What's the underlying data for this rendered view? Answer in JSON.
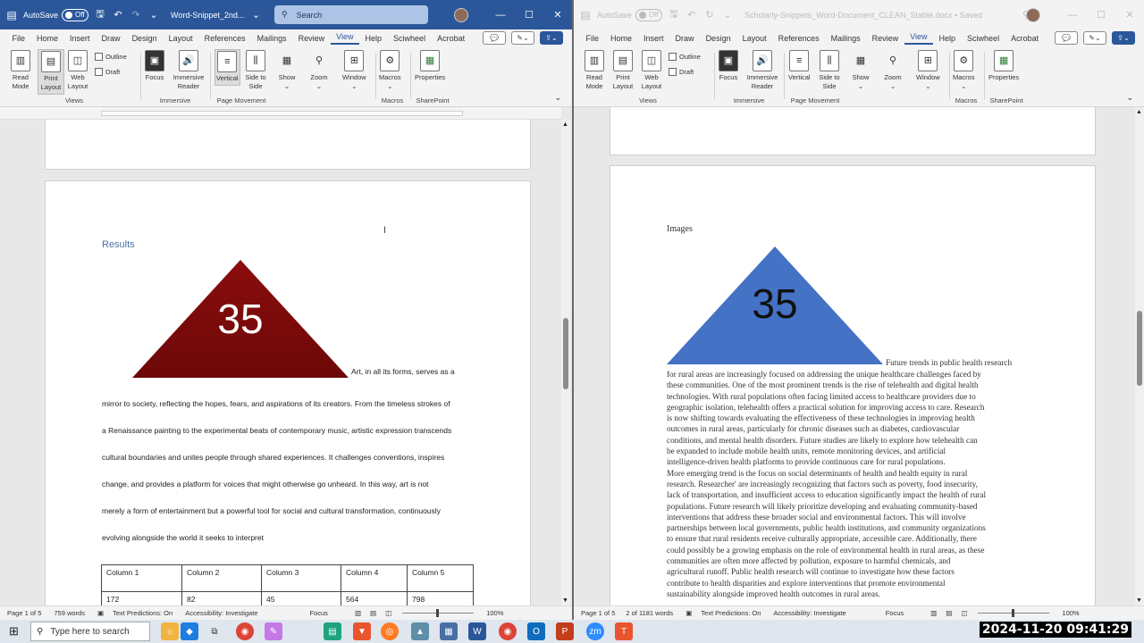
{
  "left": {
    "autosave_label": "AutoSave",
    "autosave_state": "Off",
    "doc_title": "Word-Snippet_2nd...",
    "search_placeholder": "Search",
    "menu": [
      "File",
      "Home",
      "Insert",
      "Draw",
      "Design",
      "Layout",
      "References",
      "Mailings",
      "Review",
      "View",
      "Help",
      "Sciwheel",
      "Acrobat"
    ],
    "active_menu": "View",
    "ribbon": {
      "read_mode": "Read Mode",
      "print_layout": "Print Layout",
      "web_layout": "Web Layout",
      "outline": "Outline",
      "draft": "Draft",
      "views_group": "Views",
      "focus": "Focus",
      "immersive_reader": "Immersive Reader",
      "immersive_group": "Immersive",
      "vertical": "Vertical",
      "side_to_side": "Side to Side",
      "page_movement_group": "Page Movement",
      "show": "Show",
      "zoom": "Zoom",
      "window": "Window",
      "macros": "Macros",
      "macros_group": "Macros",
      "properties": "Properties",
      "sharepoint_group": "SharePoint"
    },
    "document": {
      "heading": "Results",
      "shape_number": "35",
      "paragraph_lines": [
        "Art, in all its forms, serves as a",
        "mirror to society, reflecting the hopes, fears, and aspirations of its creators. From the timeless strokes of",
        "a Renaissance painting to the experimental beats of contemporary music, artistic expression transcends",
        "cultural boundaries and unites people through shared experiences. It challenges conventions, inspires",
        "change, and provides a platform for voices that might otherwise go unheard. In this way, art is not",
        "merely a form of entertainment but a powerful tool for social and cultural transformation, continuously",
        "evolving alongside the world it seeks to interpret"
      ],
      "table_headers": [
        "Column 1",
        "Column 2",
        "Column 3",
        "Column 4",
        "Column 5"
      ],
      "table_rows": [
        [
          "172",
          "82",
          "45",
          "564",
          "798"
        ]
      ]
    },
    "status": {
      "page": "Page 1 of 5",
      "words": "759 words",
      "text_predictions": "Text Predictions: On",
      "accessibility": "Accessibility: Investigate",
      "focus": "Focus",
      "zoom": "100%"
    }
  },
  "right": {
    "autosave_label": "AutoSave",
    "autosave_state": "Off",
    "doc_title": "Scholarly-Snippets_Word-Document_CLEAN_Stable.docx • Saved",
    "menu": [
      "File",
      "Home",
      "Insert",
      "Draw",
      "Design",
      "Layout",
      "References",
      "Mailings",
      "Review",
      "View",
      "Help",
      "Sciwheel",
      "Acrobat"
    ],
    "active_menu": "View",
    "document": {
      "heading": "Images",
      "shape_number": "35",
      "first_line": "Future trends in public health research",
      "paragraph_lines": [
        "for rural areas are increasingly focused on addressing the unique healthcare challenges faced by",
        "these communities. One of the most prominent trends is the rise of telehealth and digital health",
        "technologies. With rural populations often facing limited access to healthcare providers due to",
        "geographic isolation, telehealth offers a practical solution for improving access to care. Research",
        "is now shifting towards evaluating the effectiveness of these technologies in improving health",
        "outcomes in rural areas, particularly for chronic diseases such as diabetes, cardiovascular",
        "conditions, and mental health disorders. Future studies are likely to explore how telehealth can",
        "be expanded to include mobile health units, remote monitoring devices, and artificial",
        "intelligence-driven health platforms to provide continuous care for rural populations.",
        "More emerging trend is the focus on social determinants of health and health equity in rural",
        "research. Researcher' are increasingly recognizing that factors such as poverty, food insecurity,",
        "lack of transportation, and insufficient access to education significantly impact the health of rural",
        "populations. Future research will likely prioritize developing and evaluating community-based",
        "interventions that address these broader social and environmental factors. This will involve",
        "partnerships between local governments, public health institutions, and community organizations",
        "to ensure that rural residents receive culturally appropriate, accessible care. Additionally, there",
        "could possibly be a growing emphasis on the role of environmental health in rural areas, as these",
        "communities are often more affected by pollution, exposure to harmful chemicals, and",
        "agricultural runoff. Public health research will continue to investigate how these factors",
        "contribute to health disparities and explore interventions that promote environmental",
        "sustainability alongside improved health outcomes in rural areas."
      ]
    },
    "status": {
      "page": "Page 1 of 5",
      "words": "2 of 1181 words",
      "text_predictions": "Text Predictions: On",
      "accessibility": "Accessibility: Investigate",
      "focus": "Focus",
      "zoom": "100%"
    }
  },
  "taskbar": {
    "search_placeholder": "Type here to search",
    "clock": "2024-11-20  09:41:29"
  },
  "colors": {
    "word_blue": "#2b579a",
    "red_triangle": "#8b0d0d",
    "blue_triangle": "#4472c4",
    "heading_blue": "#4a6fa5"
  }
}
